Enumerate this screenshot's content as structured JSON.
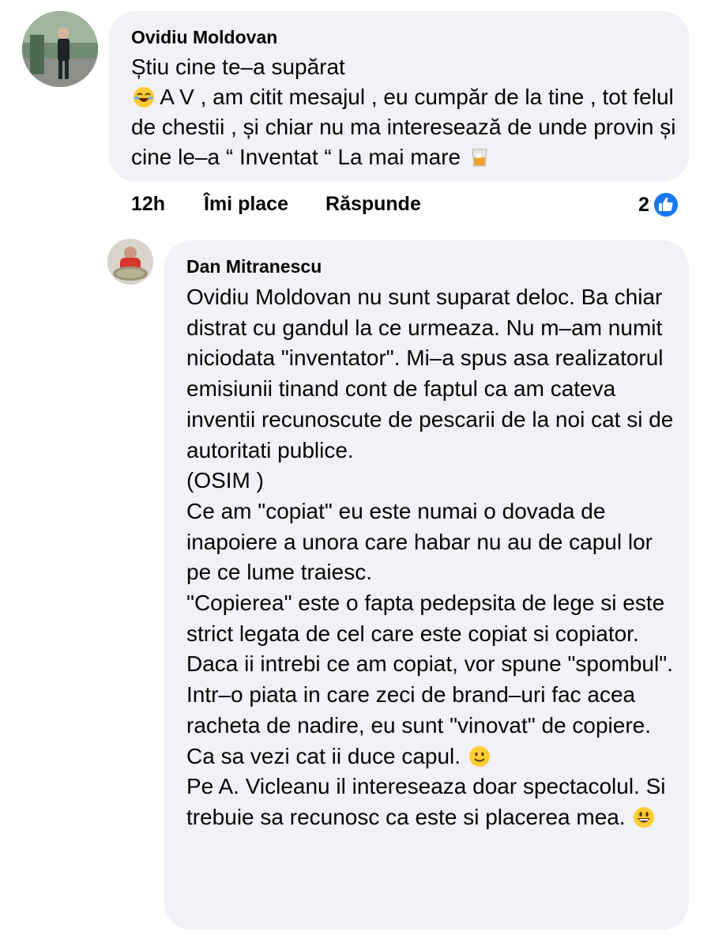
{
  "comment": {
    "author": "Ovidiu Moldovan",
    "text_before_emoji": "Știu cine te–a supărat",
    "emoji_1": "rolling-on-floor-laughing-emoji",
    "text_after_emoji": " A V , am citit mesajul , eu cumpăr de la tine , tot felul de chestii , și chiar nu ma interesează de unde provin și cine le–a “ Inventat “ La mai mare ",
    "emoji_2": "tumbler-glass-emoji",
    "time": "12h",
    "like_label": "Îmi place",
    "reply_label": "Răspunde",
    "reaction_count": "2",
    "reaction_icon": "like-reaction-icon",
    "accent_color": "#1877f2"
  },
  "reply": {
    "author": "Dan Mitranescu",
    "paragraph_1": "Ovidiu Moldovan nu sunt suparat deloc. Ba chiar distrat cu gandul la ce urmeaza. Nu m–am numit niciodata \"inventator\". Mi–a spus asa realizatorul emisiunii tinand cont de faptul ca am cateva inventii recunoscute de pescarii de la noi cat si de autoritati publice.\n(OSIM )\nCe am \"copiat\" eu este numai o dovada de inapoiere a unora care habar nu au de capul lor pe ce lume traiesc.\n\"Copierea\" este o fapta pedepsita de lege si este strict legata de cel care este copiat si copiator.\nDaca ii intrebi ce am copiat, vor spune \"spombul\". Intr–o piata in care zeci de brand–uri fac acea racheta de nadire, eu sunt \"vinovat\" de copiere. Ca sa vezi cat ii duce capul. ",
    "emoji_1": "slightly-smiling-face-emoji",
    "paragraph_2": "\nPe A. Vicleanu il intereseaza doar spectacolul. Si trebuie sa recunosc ca este si placerea mea. ",
    "emoji_2": "grinning-face-emoji"
  }
}
